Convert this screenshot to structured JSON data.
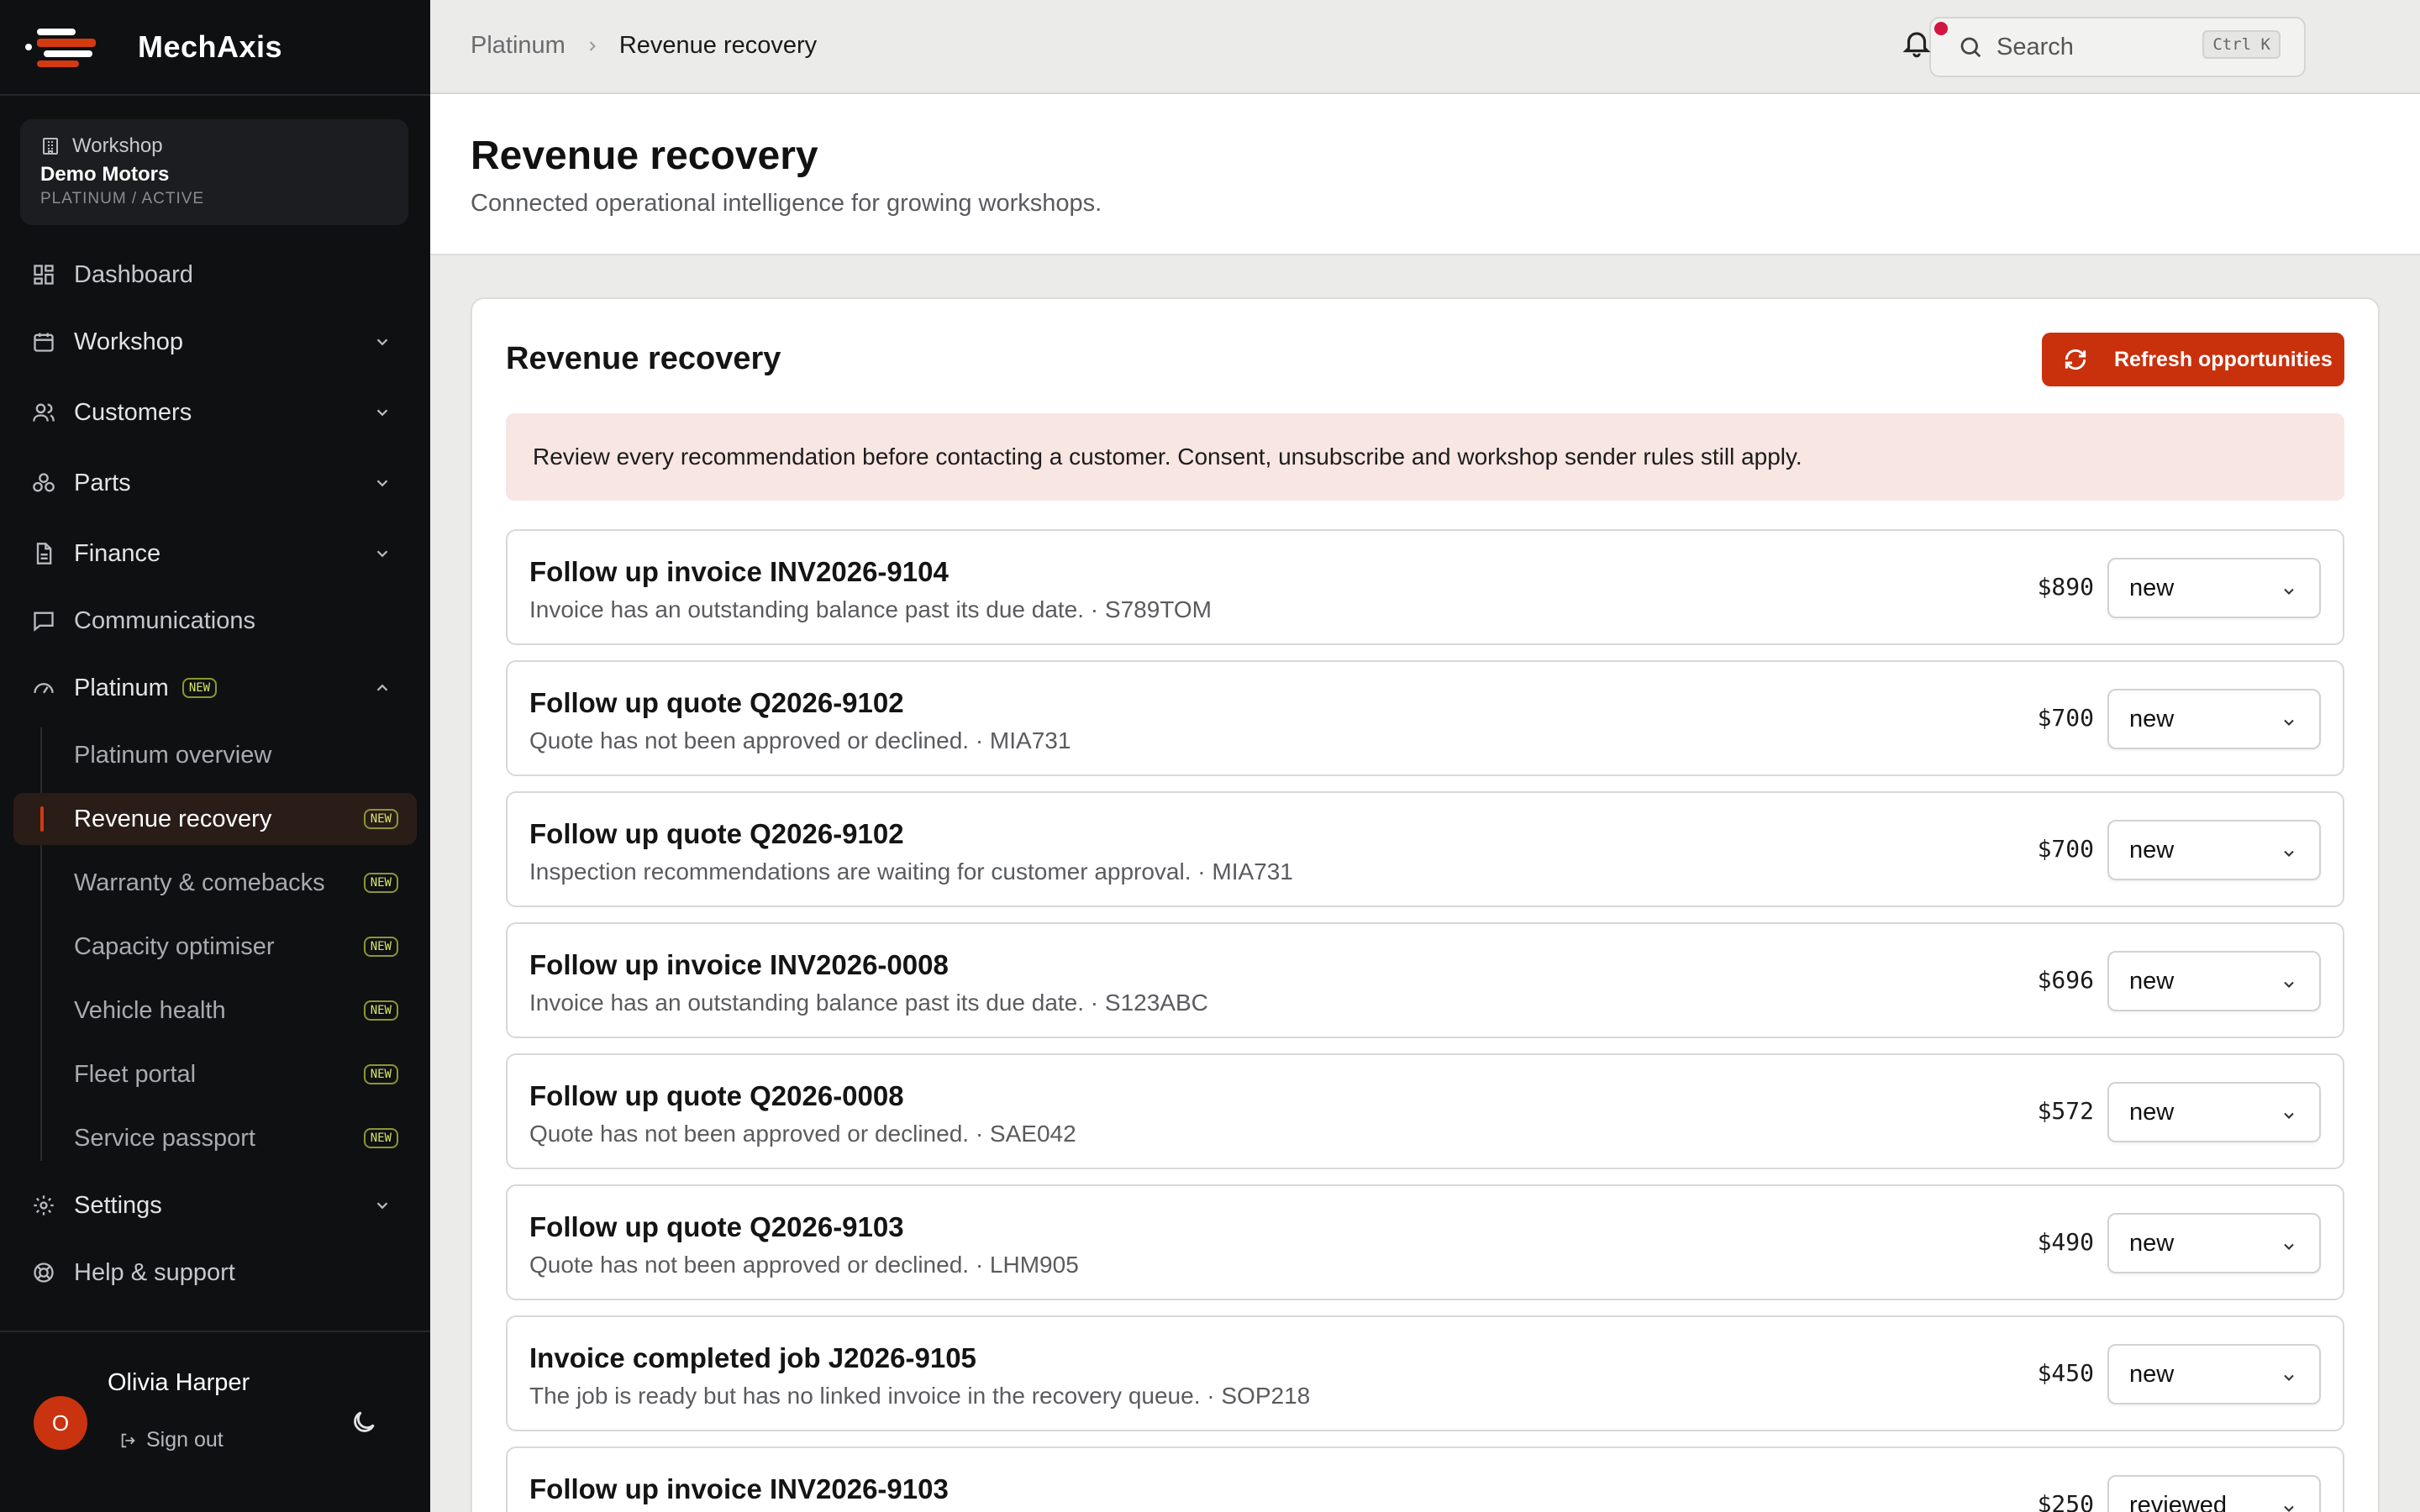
{
  "brand": {
    "name_prefix": "Mech",
    "name_suffix": "Axis",
    "colors": {
      "accent": "#c9300c",
      "sidebar_bg": "#0f1012",
      "badge_new": "#d8e36a",
      "alert_dot": "#d2163f"
    }
  },
  "workspace": {
    "label": "Workshop",
    "name": "Demo Motors",
    "plan": "PLATINUM / ACTIVE"
  },
  "nav": {
    "dashboard": "Dashboard",
    "workshop": "Workshop",
    "customers": "Customers",
    "parts": "Parts",
    "finance": "Finance",
    "communications": "Communications",
    "platinum": "Platinum",
    "platinum_badge": "NEW",
    "sub": [
      {
        "label": "Platinum overview",
        "badge": ""
      },
      {
        "label": "Revenue recovery",
        "badge": "NEW"
      },
      {
        "label": "Warranty & comebacks",
        "badge": "NEW"
      },
      {
        "label": "Capacity optimiser",
        "badge": "NEW"
      },
      {
        "label": "Vehicle health",
        "badge": "NEW"
      },
      {
        "label": "Fleet portal",
        "badge": "NEW"
      },
      {
        "label": "Service passport",
        "badge": "NEW"
      }
    ],
    "settings": "Settings",
    "help": "Help & support"
  },
  "user": {
    "initial": "O",
    "name": "Olivia Harper",
    "sign_out": "Sign out"
  },
  "topbar": {
    "breadcrumb": [
      "Platinum",
      "Revenue recovery"
    ],
    "search_placeholder": "Search",
    "search_shortcut": "Ctrl K"
  },
  "page": {
    "title": "Revenue recovery",
    "subtitle": "Connected operational intelligence for growing workshops."
  },
  "card": {
    "title": "Revenue recovery",
    "refresh_label": "Refresh opportunities",
    "notice": "Review every recommendation before contacting a customer. Consent, unsubscribe and workshop sender rules still apply.",
    "rows": [
      {
        "title": "Follow up invoice INV2026-9104",
        "desc": "Invoice has an outstanding balance past its due date. · S789TOM",
        "amount": "$890",
        "status": "new"
      },
      {
        "title": "Follow up quote Q2026-9102",
        "desc": "Quote has not been approved or declined. · MIA731",
        "amount": "$700",
        "status": "new"
      },
      {
        "title": "Follow up quote Q2026-9102",
        "desc": "Inspection recommendations are waiting for customer approval. · MIA731",
        "amount": "$700",
        "status": "new"
      },
      {
        "title": "Follow up invoice INV2026-0008",
        "desc": "Invoice has an outstanding balance past its due date. · S123ABC",
        "amount": "$696",
        "status": "new"
      },
      {
        "title": "Follow up quote Q2026-0008",
        "desc": "Quote has not been approved or declined. · SAE042",
        "amount": "$572",
        "status": "new"
      },
      {
        "title": "Follow up quote Q2026-9103",
        "desc": "Quote has not been approved or declined. · LHM905",
        "amount": "$490",
        "status": "new"
      },
      {
        "title": "Invoice completed job J2026-9105",
        "desc": "The job is ready but has no linked invoice in the recovery queue. · SOP218",
        "amount": "$450",
        "status": "new"
      },
      {
        "title": "Follow up invoice INV2026-9103",
        "desc": "",
        "amount": "$250",
        "status": "reviewed"
      }
    ]
  }
}
